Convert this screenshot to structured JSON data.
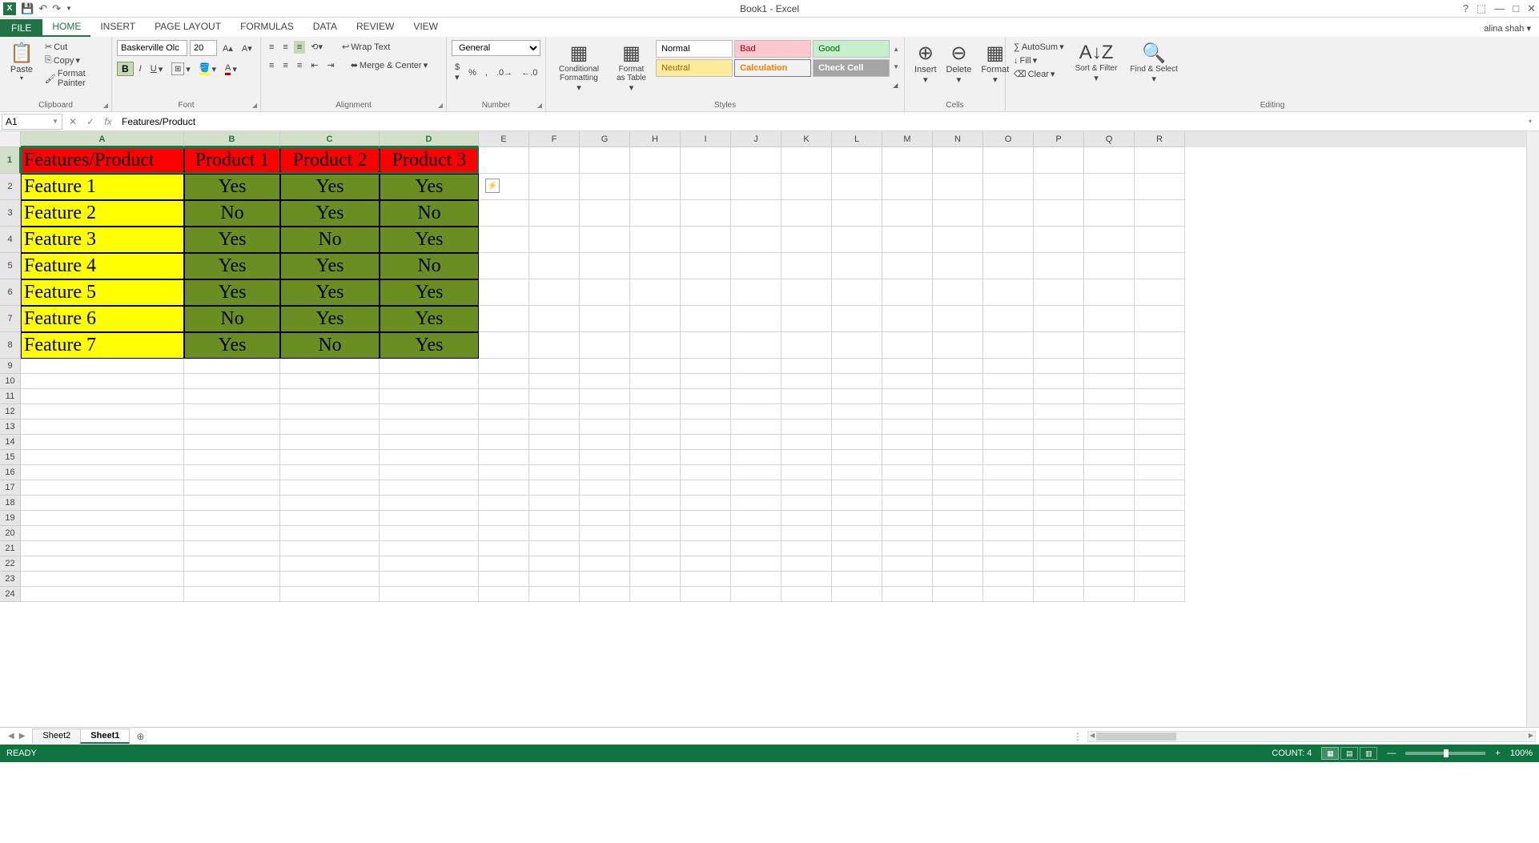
{
  "title": "Book1 - Excel",
  "user": "alina shah",
  "tabs": [
    "HOME",
    "INSERT",
    "PAGE LAYOUT",
    "FORMULAS",
    "DATA",
    "REVIEW",
    "VIEW"
  ],
  "file_tab": "FILE",
  "active_tab": "HOME",
  "clipboard": {
    "paste": "Paste",
    "cut": "Cut",
    "copy": "Copy",
    "painter": "Format Painter",
    "label": "Clipboard"
  },
  "font": {
    "name": "Baskerville Olc",
    "size": "20",
    "label": "Font"
  },
  "alignment": {
    "wrap": "Wrap Text",
    "merge": "Merge & Center",
    "label": "Alignment"
  },
  "number": {
    "format": "General",
    "label": "Number"
  },
  "styles": {
    "cond": "Conditional Formatting",
    "fat": "Format as Table",
    "normal": "Normal",
    "bad": "Bad",
    "good": "Good",
    "neutral": "Neutral",
    "calc": "Calculation",
    "check": "Check Cell",
    "label": "Styles"
  },
  "cells_grp": {
    "insert": "Insert",
    "delete": "Delete",
    "format": "Format",
    "label": "Cells"
  },
  "editing": {
    "autosum": "AutoSum",
    "fill": "Fill",
    "clear": "Clear",
    "sort": "Sort & Filter",
    "find": "Find & Select",
    "label": "Editing"
  },
  "name_box": "A1",
  "formula_value": "Features/Product",
  "columns": [
    "A",
    "B",
    "C",
    "D",
    "E",
    "F",
    "G",
    "H",
    "I",
    "J",
    "K",
    "L",
    "M",
    "N",
    "O",
    "P",
    "Q",
    "R"
  ],
  "col_widths": {
    "A": 204,
    "B": 120,
    "C": 124,
    "D": 124,
    "rest": 63
  },
  "selected_cols": [
    "A",
    "B",
    "C",
    "D"
  ],
  "selected_rows": [
    1
  ],
  "data_rows": 8,
  "row_heights": {
    "data": 33,
    "rest": 19
  },
  "total_rows": 24,
  "chart_data": {
    "type": "table",
    "headers": [
      "Features/Product",
      "Product 1",
      "Product 2",
      "Product 3"
    ],
    "rows": [
      [
        "Feature 1",
        "Yes",
        "Yes",
        "Yes"
      ],
      [
        "Feature 2",
        "No",
        "Yes",
        "No"
      ],
      [
        "Feature 3",
        "Yes",
        "No",
        "Yes"
      ],
      [
        "Feature 4",
        "Yes",
        "Yes",
        "No"
      ],
      [
        "Feature 5",
        "Yes",
        "Yes",
        "Yes"
      ],
      [
        "Feature 6",
        "No",
        "Yes",
        "Yes"
      ],
      [
        "Feature 7",
        "Yes",
        "No",
        "Yes"
      ]
    ]
  },
  "sheets": [
    "Sheet2",
    "Sheet1"
  ],
  "active_sheet": "Sheet1",
  "status": {
    "ready": "READY",
    "count_label": "COUNT:",
    "count": "4",
    "zoom": "100%"
  }
}
